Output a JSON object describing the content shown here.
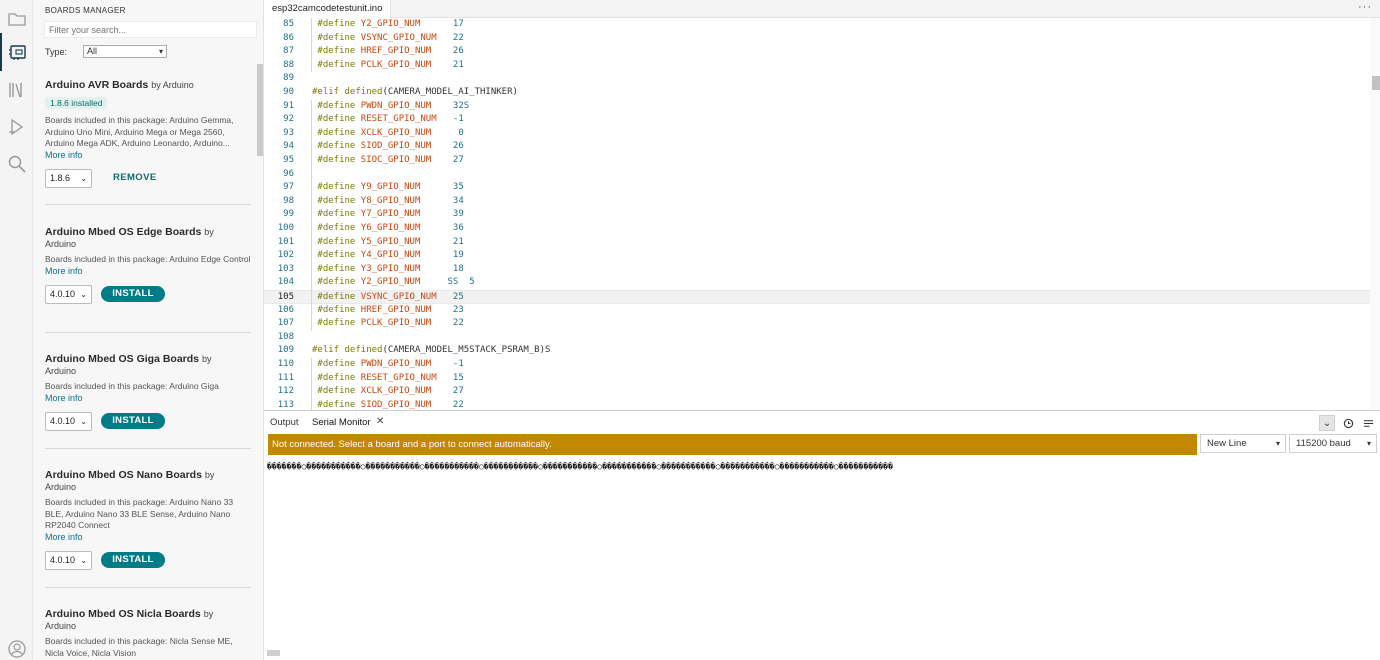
{
  "colors": {
    "accent": "#007c86",
    "warning": "#c18800",
    "keyword": "#7a7a00",
    "macro": "#c7470f",
    "number": "#1f6f87"
  },
  "activity_bar": {
    "icons": [
      "folder-icon",
      "boards-manager-icon",
      "library-icon",
      "debug-icon",
      "search-icon",
      "account-icon"
    ]
  },
  "boards_manager": {
    "title": "BOARDS MANAGER",
    "search_placeholder": "Filter your search...",
    "type_label": "Type:",
    "type_value": "All",
    "boards": [
      {
        "name": "Arduino AVR Boards",
        "by": "by Arduino",
        "author": "",
        "installed": "1.8.6 installed",
        "desc": "Boards included in this package: Arduino Gemma, Arduino Uno Mini, Arduino Mega or Mega 2560, Arduino Mega ADK, Arduino Leonardo, Arduino...",
        "more": "More info",
        "version": "1.8.6",
        "action": "REMOVE"
      },
      {
        "name": "Arduino Mbed OS Edge Boards",
        "by": "by",
        "author": "Arduino",
        "desc": "Boards included in this package: Arduino Edge Control",
        "more": "More info",
        "version": "4.0.10",
        "action": "INSTALL"
      },
      {
        "name": "Arduino Mbed OS Giga Boards",
        "by": "by",
        "author": "Arduino",
        "desc": "Boards included in this package: Arduino Giga",
        "more": "More info",
        "version": "4.0.10",
        "action": "INSTALL"
      },
      {
        "name": "Arduino Mbed OS Nano Boards",
        "by": "by",
        "author": "Arduino",
        "desc": "Boards included in this package: Arduino Nano 33 BLE, Arduino Nano 33 BLE Sense, Arduino Nano RP2040 Connect",
        "more": "More info",
        "version": "4.0.10",
        "action": "INSTALL"
      },
      {
        "name": "Arduino Mbed OS Nicla Boards",
        "by": "by",
        "author": "Arduino",
        "desc": "Boards included in this package: Nicla Sense ME, Nicla Voice, Nicla Vision"
      }
    ]
  },
  "editor": {
    "tab": "esp32camcodetestunit.ino",
    "more_icon": "···",
    "current_line": "105",
    "lines": [
      {
        "n": "85",
        "t": "def",
        "m": "Y2_GPIO_NUM",
        "pad": "      ",
        "v": "17"
      },
      {
        "n": "86",
        "t": "def",
        "m": "VSYNC_GPIO_NUM",
        "pad": "   ",
        "v": "22"
      },
      {
        "n": "87",
        "t": "def",
        "m": "HREF_GPIO_NUM",
        "pad": "    ",
        "v": "26"
      },
      {
        "n": "88",
        "t": "def",
        "m": "PCLK_GPIO_NUM",
        "pad": "    ",
        "v": "21"
      },
      {
        "n": "89",
        "t": "blank"
      },
      {
        "n": "90",
        "t": "elif",
        "arg": "(CAMERA_MODEL_AI_THINKER)"
      },
      {
        "n": "91",
        "t": "def",
        "m": "PWDN_GPIO_NUM",
        "pad": "    ",
        "v": "32S"
      },
      {
        "n": "92",
        "t": "def",
        "m": "RESET_GPIO_NUM",
        "pad": "   ",
        "v": "-1"
      },
      {
        "n": "93",
        "t": "def",
        "m": "XCLK_GPIO_NUM",
        "pad": "     ",
        "v": "0"
      },
      {
        "n": "94",
        "t": "def",
        "m": "SIOD_GPIO_NUM",
        "pad": "    ",
        "v": "26"
      },
      {
        "n": "95",
        "t": "def",
        "m": "SIOC_GPIO_NUM",
        "pad": "    ",
        "v": "27"
      },
      {
        "n": "96",
        "t": "blank"
      },
      {
        "n": "97",
        "t": "def",
        "m": "Y9_GPIO_NUM",
        "pad": "      ",
        "v": "35"
      },
      {
        "n": "98",
        "t": "def",
        "m": "Y8_GPIO_NUM",
        "pad": "      ",
        "v": "34"
      },
      {
        "n": "99",
        "t": "def",
        "m": "Y7_GPIO_NUM",
        "pad": "      ",
        "v": "39"
      },
      {
        "n": "100",
        "t": "def",
        "m": "Y6_GPIO_NUM",
        "pad": "      ",
        "v": "36"
      },
      {
        "n": "101",
        "t": "def",
        "m": "Y5_GPIO_NUM",
        "pad": "      ",
        "v": "21"
      },
      {
        "n": "102",
        "t": "def",
        "m": "Y4_GPIO_NUM",
        "pad": "      ",
        "v": "19"
      },
      {
        "n": "103",
        "t": "def",
        "m": "Y3_GPIO_NUM",
        "pad": "      ",
        "v": "18"
      },
      {
        "n": "104",
        "t": "def",
        "m": "Y2_GPIO_NUM",
        "pad": "     ",
        "v": "SS  5"
      },
      {
        "n": "105",
        "t": "def",
        "m": "VSYNC_GPIO_NUM",
        "pad": "   ",
        "v": "25"
      },
      {
        "n": "106",
        "t": "def",
        "m": "HREF_GPIO_NUM",
        "pad": "    ",
        "v": "23"
      },
      {
        "n": "107",
        "t": "def",
        "m": "PCLK_GPIO_NUM",
        "pad": "    ",
        "v": "22"
      },
      {
        "n": "108",
        "t": "blank"
      },
      {
        "n": "109",
        "t": "elif",
        "arg": "(CAMERA_MODEL_M5STACK_PSRAM_B)S"
      },
      {
        "n": "110",
        "t": "def",
        "m": "PWDN_GPIO_NUM",
        "pad": "    ",
        "v": "-1"
      },
      {
        "n": "111",
        "t": "def",
        "m": "RESET_GPIO_NUM",
        "pad": "   ",
        "v": "15"
      },
      {
        "n": "112",
        "t": "def",
        "m": "XCLK_GPIO_NUM",
        "pad": "    ",
        "v": "27"
      },
      {
        "n": "113",
        "t": "def",
        "m": "SIOD_GPIO_NUM",
        "pad": "    ",
        "v": "22"
      }
    ]
  },
  "panel": {
    "tab_output": "Output",
    "tab_serial": "Serial Monitor",
    "notice": "Not connected. Select a board and a port to connect automatically.",
    "line_ending": "New Line",
    "baud": "115200 baud",
    "serial_text": "�������○�����������○�����������○�����������○�����������○�����������○�����������○�����������○�����������○�����������○�����������"
  }
}
